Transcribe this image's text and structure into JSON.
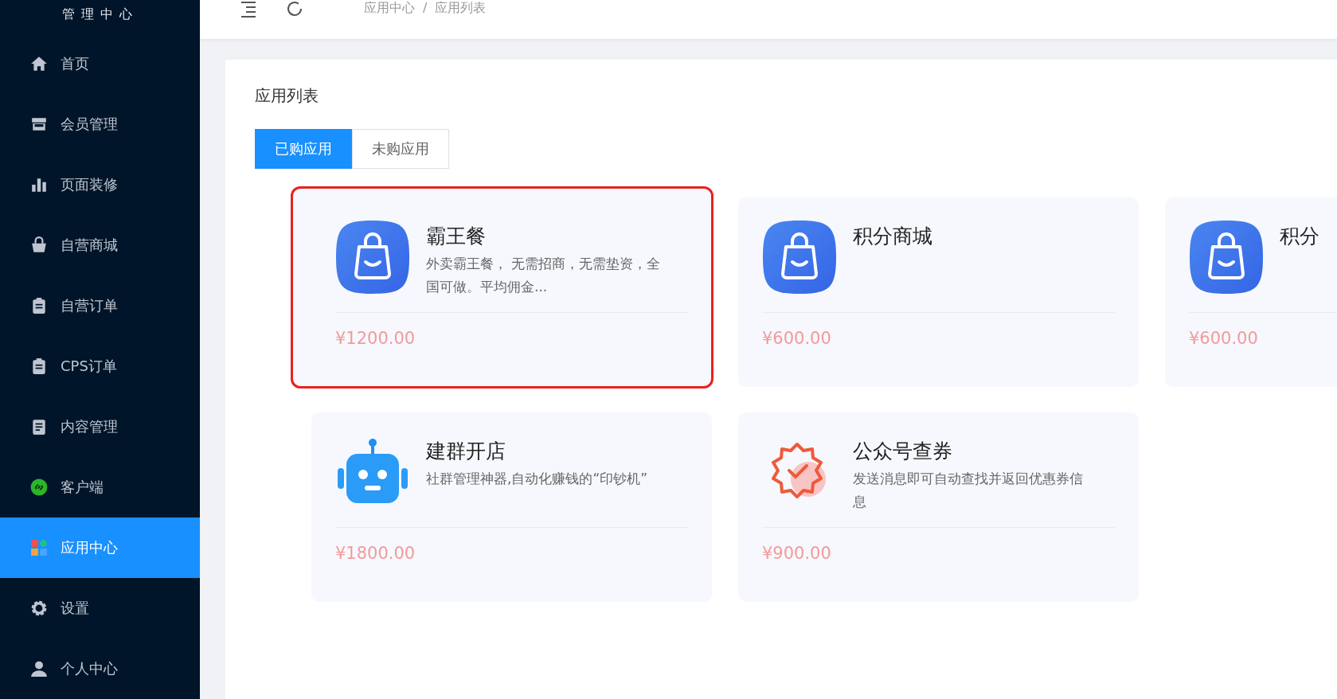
{
  "sidebar": {
    "title": "管理中心",
    "items": [
      {
        "label": "首页",
        "selected": false
      },
      {
        "label": "会员管理",
        "selected": false
      },
      {
        "label": "页面装修",
        "selected": false
      },
      {
        "label": "自营商城",
        "selected": false
      },
      {
        "label": "自营订单",
        "selected": false
      },
      {
        "label": "CPS订单",
        "selected": false
      },
      {
        "label": "内容管理",
        "selected": false
      },
      {
        "label": "客户端",
        "selected": false
      },
      {
        "label": "应用中心",
        "selected": true
      },
      {
        "label": "设置",
        "selected": false
      },
      {
        "label": "个人中心",
        "selected": false
      }
    ]
  },
  "breadcrumb": {
    "items": [
      "应用中心",
      "应用列表"
    ],
    "separator": "/"
  },
  "panel": {
    "title": "应用列表",
    "tabs": [
      {
        "label": "已购应用",
        "selected": true
      },
      {
        "label": "未购应用",
        "selected": false
      }
    ],
    "cards": [
      {
        "kind": "bag",
        "name": "霸王餐",
        "description": "外卖霸王餐， 无需招商，无需垫资，全国可做。平均佣金...",
        "price": "¥1200.00",
        "highlighted": true
      },
      {
        "kind": "bag",
        "name": "积分商城",
        "price": "¥600.00",
        "highlighted": false
      },
      {
        "kind": "bag",
        "name": "积分",
        "price": "¥600.00",
        "highlighted": false
      },
      {
        "kind": "robot",
        "name": "建群开店",
        "description": "社群管理神器,自动化赚钱的“印钞机”",
        "price": "¥1800.00",
        "highlighted": false
      },
      {
        "kind": "badge",
        "name": "公众号查券",
        "description": "发送消息即可自动查找并返回优惠券信息",
        "price": "¥900.00",
        "highlighted": false
      }
    ]
  }
}
